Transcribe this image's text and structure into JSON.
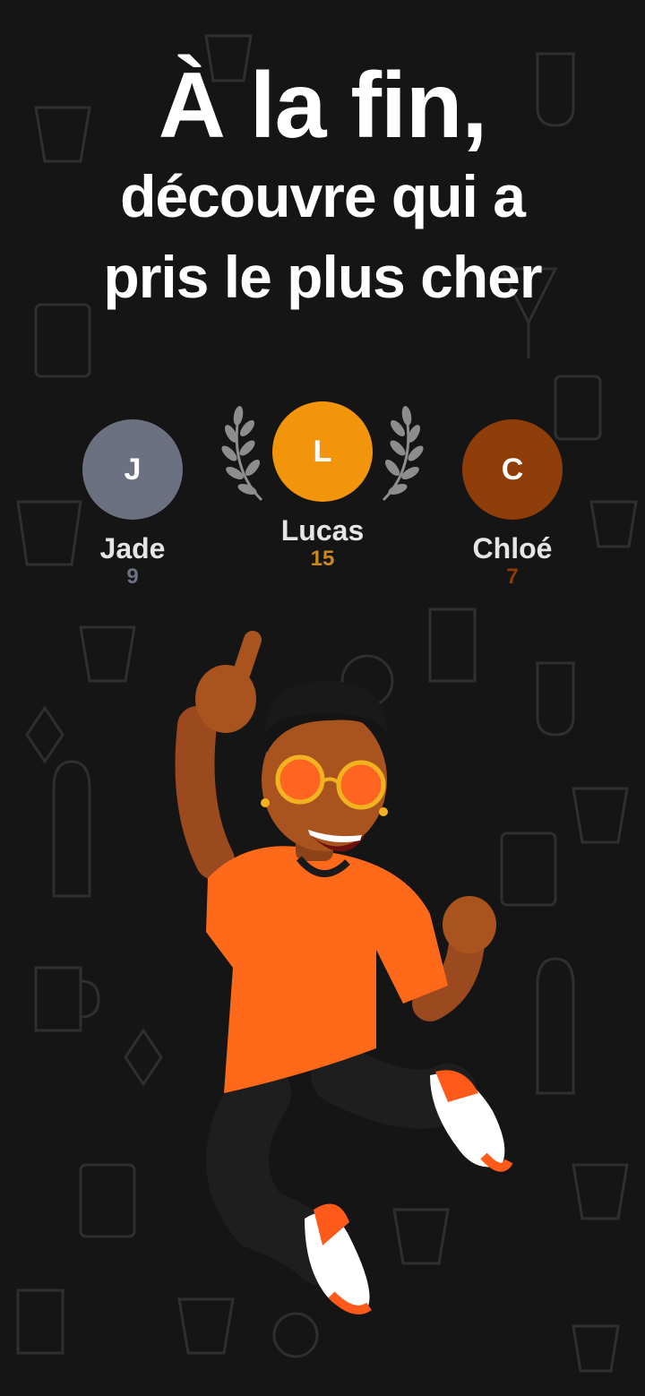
{
  "headline": {
    "line1": "À la fin,",
    "line2": "découvre qui a",
    "line3": "pris le plus cher"
  },
  "podium": {
    "players": [
      {
        "rank": 2,
        "initial": "J",
        "name": "Jade",
        "score": "9",
        "avatar_color": "#6b7180",
        "score_color": "#6b7180"
      },
      {
        "rank": 1,
        "initial": "L",
        "name": "Lucas",
        "score": "15",
        "avatar_color": "#f3950b",
        "score_color": "#c9871c"
      },
      {
        "rank": 3,
        "initial": "C",
        "name": "Chloé",
        "score": "7",
        "avatar_color": "#8e3d08",
        "score_color": "#8e3d08"
      }
    ]
  },
  "colors": {
    "background": "#151515",
    "accent": "#f3950b",
    "laurel": "#8d8d8d"
  },
  "illustration": {
    "subject": "celebrating-character",
    "shirt_color": "#ff6a1a"
  }
}
